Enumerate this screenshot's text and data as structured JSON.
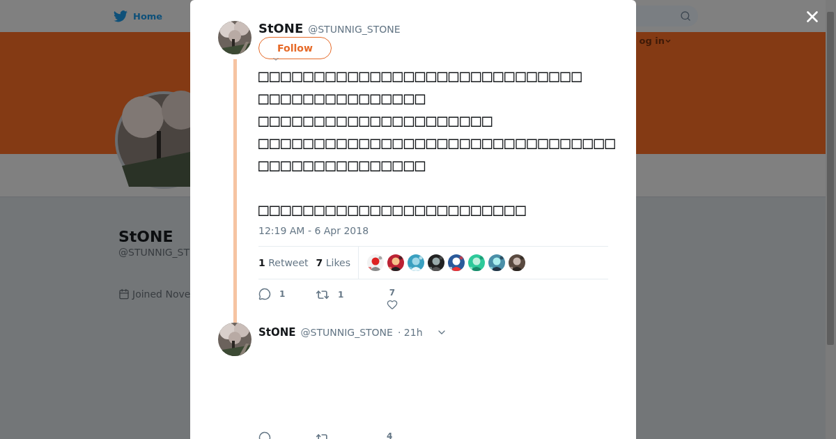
{
  "background_page": {
    "nav": {
      "home": "Home",
      "login": "og in"
    },
    "profile": {
      "name": "StONE",
      "handle": "@STUNNIG_ST",
      "joined": "Joined Nove"
    }
  },
  "modal": {
    "tweet": {
      "author_name": "StONE",
      "handle": "@STUNNIG_STONE",
      "follow_button": "Follow",
      "text": "□□□□□□□□□□□□□□□□□□□□□□□□□□□□□\n□□□□□□□□□□□□□□□\n□□□□□□□□□□□□□□□□□□□□□\n□□□□□□□□□□□□□□□□□□□□□□□□□□□□□□□□\n□□□□□□□□□□□□□□□\n\n□□□□□□□□□□□□□□□□□□□□□□□□",
      "timestamp": "12:19 AM - 6 Apr 2018",
      "retweet_count": "1",
      "retweet_label": "Retweet",
      "like_count": "7",
      "like_label": "Likes",
      "actions": {
        "replies": "1",
        "retweets": "1",
        "likes": "7"
      }
    },
    "reply": {
      "author_name": "StONE",
      "handle": "@STUNNIG_STONE",
      "time": "· 21h",
      "actions": {
        "likes": "4"
      }
    }
  }
}
